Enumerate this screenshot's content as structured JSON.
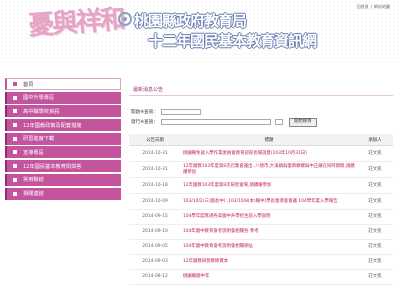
{
  "header": {
    "logo_text": "憂與祥和",
    "title_line1": "桃園縣政府教育局",
    "title_line2": "十二年國民基本教育資訊網",
    "top_links": [
      "回首頁",
      "網站地圖"
    ]
  },
  "sidebar": {
    "items": [
      {
        "label": "首頁"
      },
      {
        "label": "國中升學專區"
      },
      {
        "label": "高中職學校資訊"
      },
      {
        "label": "12年國教政策及配套措施"
      },
      {
        "label": "研習進度下載"
      },
      {
        "label": "宣導專區"
      },
      {
        "label": "12年國民基本教育問與答"
      },
      {
        "label": "常用聯結"
      },
      {
        "label": "相關連結"
      }
    ]
  },
  "main": {
    "section_title": "最新消息公告",
    "search": {
      "date_label": "開啟※查詢：",
      "keyword_label": "發行※查詢：",
      "button_label": "開始搜尋"
    },
    "table": {
      "headers": [
        "公告日期",
        "標題",
        "承辦人"
      ],
      "rows": [
        {
          "date": "2014-10-31",
          "title": "桃園縣免試入學作業委員會教育部部長場說意(103年10月31日)",
          "owner": "莊文凱"
        },
        {
          "date": "2014-10-31",
          "title": "12年國教103年度第8次召集會議出..八德市,大溪鎮與復興鄉鄉與中正鎮在同時期間,請踴躍參加",
          "owner": "莊文凱"
        },
        {
          "date": "2014-10-18",
          "title": "12年國教103年度第8次研習會場,請踴躍參加",
          "owner": "莊文凱"
        },
        {
          "date": "2014-10-09",
          "title": "103/10/2(三)國長中) ,103/10/8(本)繼中(學長督導會會議 104學年度入學報告",
          "owner": "莊文凱"
        },
        {
          "date": "2014-09-15",
          "title": "104學年度無適各高國中升學招生說入學說明",
          "owner": "莊文凱"
        },
        {
          "date": "2014-09-10",
          "title": "104年國中教育會考說明會相關各 參考",
          "owner": "莊文凱"
        },
        {
          "date": "2014-09-05",
          "title": "104年國中教育會考說明會相關網址",
          "owner": "莊文凱"
        },
        {
          "date": "2014-09-03",
          "title": "12年國教研習教師資本",
          "owner": "莊文凱"
        },
        {
          "date": "2014-08-12",
          "title": "桃園縣國中年",
          "owner": "莊文凱"
        }
      ]
    }
  },
  "colors": {
    "accent": "#c4549e",
    "link": "#c2185b",
    "title_stroke": "#667bb0"
  }
}
